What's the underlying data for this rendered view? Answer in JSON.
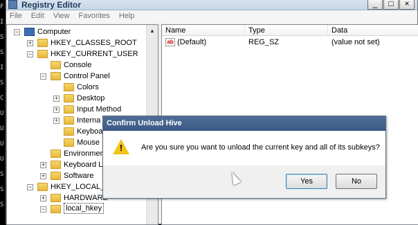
{
  "window": {
    "title": "Registry Editor"
  },
  "menu": [
    "File",
    "Edit",
    "View",
    "Favorites",
    "Help"
  ],
  "console_chars": [
    "F",
    "I",
    "S",
    "S",
    "I",
    "S",
    "C",
    "U",
    "U",
    "U",
    "U",
    "S",
    "S",
    "S"
  ],
  "tree": [
    {
      "label": "Computer",
      "expander": "−",
      "icon": "computer"
    },
    {
      "label": "HKEY_CLASSES_ROOT",
      "expander": "+",
      "icon": "folder"
    },
    {
      "label": "HKEY_CURRENT_USER",
      "expander": "−",
      "icon": "folder"
    },
    {
      "label": "Console",
      "expander": "",
      "icon": "folder"
    },
    {
      "label": "Control Panel",
      "expander": "−",
      "icon": "folder"
    },
    {
      "label": "Colors",
      "expander": "",
      "icon": "folder"
    },
    {
      "label": "Desktop",
      "expander": "+",
      "icon": "folder"
    },
    {
      "label": "Input Method",
      "expander": "+",
      "icon": "folder"
    },
    {
      "label": "Interna",
      "expander": "+",
      "icon": "folder"
    },
    {
      "label": "Keyboa",
      "expander": "",
      "icon": "folder"
    },
    {
      "label": "Mouse",
      "expander": "",
      "icon": "folder"
    },
    {
      "label": "Environmen",
      "expander": "",
      "icon": "folder"
    },
    {
      "label": "Keyboard La",
      "expander": "+",
      "icon": "folder"
    },
    {
      "label": "Software",
      "expander": "+",
      "icon": "folder"
    },
    {
      "label": "HKEY_LOCAL_M",
      "expander": "−",
      "icon": "folder"
    },
    {
      "label": "HARDWARE",
      "expander": "+",
      "icon": "folder"
    },
    {
      "label": "local_hkey",
      "expander": "−",
      "icon": "folder",
      "selected": true
    }
  ],
  "list": {
    "columns": [
      "Name",
      "Type",
      "Data"
    ],
    "rows": [
      {
        "name": "(Default)",
        "type": "REG_SZ",
        "data": "(value not set)"
      }
    ]
  },
  "dialog": {
    "title": "Confirm Unload Hive",
    "message": "Are you sure you want to unload the current key and all of its subkeys?",
    "yes_label": "Yes",
    "no_label": "No"
  }
}
